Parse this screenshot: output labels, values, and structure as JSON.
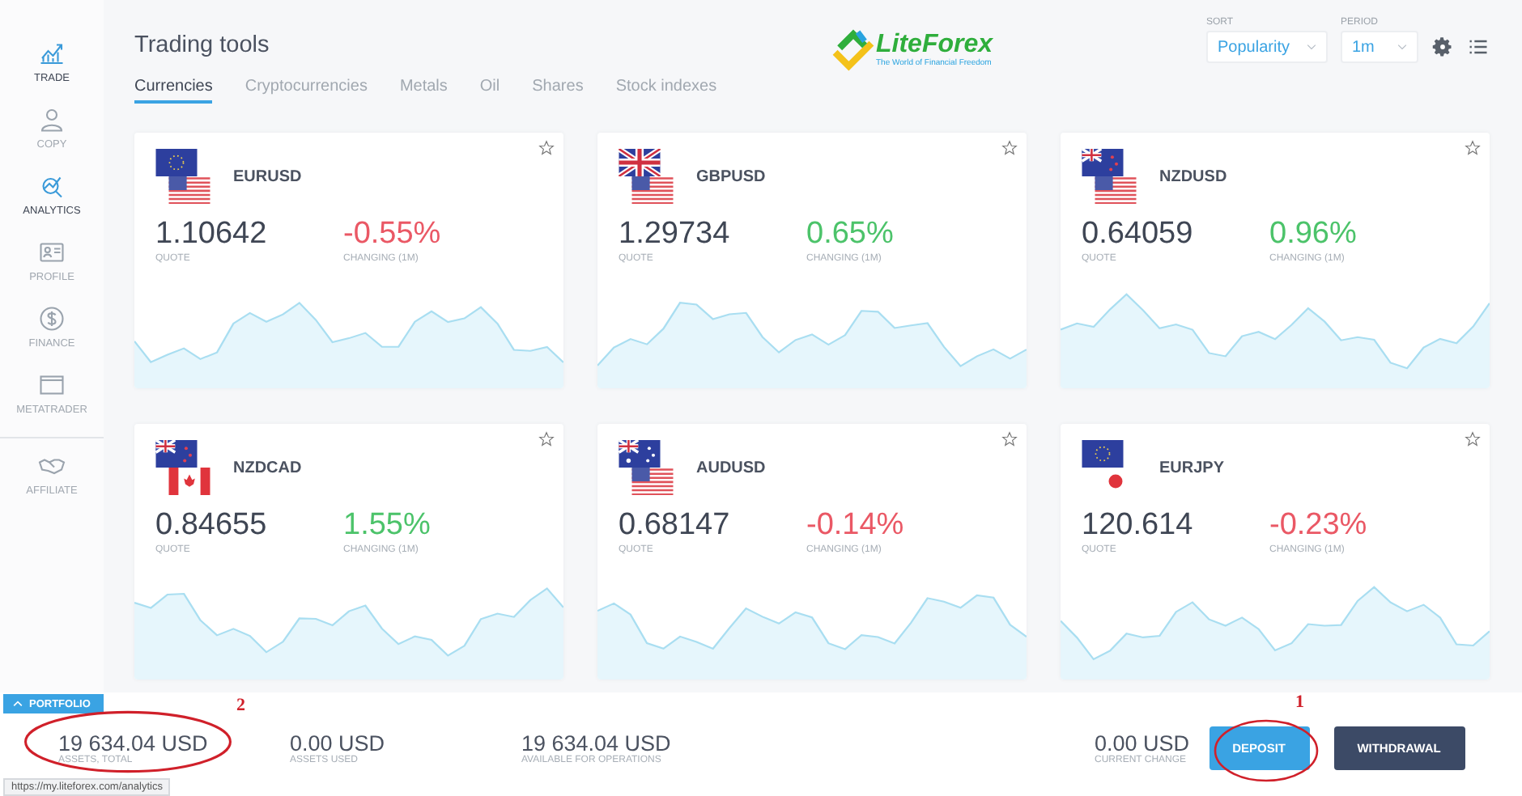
{
  "sidebar": {
    "items": [
      {
        "label": "TRADE",
        "kind": "chart",
        "selected": true
      },
      {
        "label": "COPY",
        "kind": "person",
        "selected": false
      },
      {
        "label": "ANALYTICS",
        "kind": "analytics",
        "selected": true
      },
      {
        "label": "PROFILE",
        "kind": "card",
        "selected": false
      },
      {
        "label": "FINANCE",
        "kind": "dollar",
        "selected": false
      },
      {
        "label": "METATRADER",
        "kind": "window",
        "selected": false
      },
      {
        "label": "AFFILIATE",
        "kind": "handshake",
        "selected": false
      }
    ]
  },
  "header": {
    "title": "Trading tools",
    "logo": {
      "name": "LiteForex",
      "tagline": "The World of Financial Freedom"
    },
    "sort": {
      "label": "SORT",
      "value": "Popularity"
    },
    "period": {
      "label": "PERIOD",
      "value": "1m"
    }
  },
  "tabs": [
    {
      "label": "Currencies",
      "selected": true
    },
    {
      "label": "Cryptocurrencies",
      "selected": false
    },
    {
      "label": "Metals",
      "selected": false
    },
    {
      "label": "Oil",
      "selected": false
    },
    {
      "label": "Shares",
      "selected": false
    },
    {
      "label": "Stock indexes",
      "selected": false
    }
  ],
  "instruments": [
    {
      "pair": "EURUSD",
      "flags": [
        {
          "kind": "eu"
        },
        {
          "kind": "us"
        }
      ],
      "quote": "1.10642",
      "quote_label": "QUOTE",
      "change": "-0.55%",
      "change_label": "CHANGING (1M)",
      "color": "#ea5865"
    },
    {
      "pair": "GBPUSD",
      "flags": [
        {
          "kind": "gb"
        },
        {
          "kind": "us"
        }
      ],
      "quote": "1.29734",
      "quote_label": "QUOTE",
      "change": "0.65%",
      "change_label": "CHANGING (1M)",
      "color": "#4cc36a"
    },
    {
      "pair": "NZDUSD",
      "flags": [
        {
          "kind": "nz"
        },
        {
          "kind": "us"
        }
      ],
      "quote": "0.64059",
      "quote_label": "QUOTE",
      "change": "0.96%",
      "change_label": "CHANGING (1M)",
      "color": "#4cc36a"
    },
    {
      "pair": "NZDCAD",
      "flags": [
        {
          "kind": "nz"
        },
        {
          "kind": "ca"
        }
      ],
      "quote": "0.84655",
      "quote_label": "QUOTE",
      "change": "1.55%",
      "change_label": "CHANGING (1M)",
      "color": "#4cc36a"
    },
    {
      "pair": "AUDUSD",
      "flags": [
        {
          "kind": "au"
        },
        {
          "kind": "us"
        }
      ],
      "quote": "0.68147",
      "quote_label": "QUOTE",
      "change": "-0.14%",
      "change_label": "CHANGING (1M)",
      "color": "#ea5865"
    },
    {
      "pair": "EURJPY",
      "flags": [
        {
          "kind": "eu"
        },
        {
          "kind": "jp"
        }
      ],
      "quote": "120.614",
      "quote_label": "QUOTE",
      "change": "-0.23%",
      "change_label": "CHANGING (1M)",
      "color": "#ea5865"
    }
  ],
  "portfolio": {
    "tab": "PORTFOLIO",
    "stats": [
      {
        "value": "19 634.04 USD",
        "label": "ASSETS, TOTAL"
      },
      {
        "value": "0.00 USD",
        "label": "ASSETS USED"
      },
      {
        "value": "19 634.04 USD",
        "label": "AVAILABLE FOR OPERATIONS"
      }
    ],
    "current": {
      "value": "0.00 USD",
      "label": "CURRENT CHANGE"
    },
    "buttons": [
      {
        "label": "DEPOSIT",
        "kind": "primary"
      },
      {
        "label": "WITHDRAWAL",
        "kind": "secondary"
      }
    ]
  },
  "annotations": [
    "2",
    "1"
  ],
  "status_url": "https://my.liteforex.com/analytics"
}
